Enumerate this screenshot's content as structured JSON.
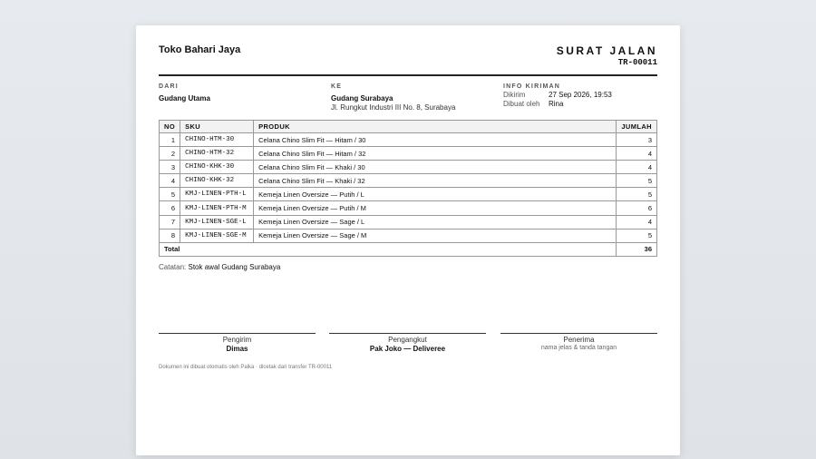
{
  "store_name": "Toko Bahari Jaya",
  "doc": {
    "title": "SURAT JALAN",
    "number": "TR-00011"
  },
  "from": {
    "label": "DARI",
    "name": "Gudang Utama"
  },
  "to": {
    "label": "KE",
    "name": "Gudang Surabaya",
    "address": "Jl. Rungkut Industri III No. 8, Surabaya"
  },
  "shipping": {
    "label": "INFO KIRIMAN",
    "sent_label": "Dikirim",
    "sent_value": "27 Sep 2026, 19:53",
    "by_label": "Dibuat oleh",
    "by_value": "Rina"
  },
  "table": {
    "headers": {
      "no": "NO",
      "sku": "SKU",
      "product": "PRODUK",
      "qty": "JUMLAH"
    },
    "rows": [
      {
        "no": "1",
        "sku": "CHINO-HTM-30",
        "product": "Celana Chino Slim Fit — Hitam / 30",
        "qty": "3"
      },
      {
        "no": "2",
        "sku": "CHINO-HTM-32",
        "product": "Celana Chino Slim Fit — Hitam / 32",
        "qty": "4"
      },
      {
        "no": "3",
        "sku": "CHINO-KHK-30",
        "product": "Celana Chino Slim Fit — Khaki / 30",
        "qty": "4"
      },
      {
        "no": "4",
        "sku": "CHINO-KHK-32",
        "product": "Celana Chino Slim Fit — Khaki / 32",
        "qty": "5"
      },
      {
        "no": "5",
        "sku": "KMJ-LINEN-PTH-L",
        "product": "Kemeja Linen Oversize — Putih / L",
        "qty": "5"
      },
      {
        "no": "6",
        "sku": "KMJ-LINEN-PTH-M",
        "product": "Kemeja Linen Oversize — Putih / M",
        "qty": "6"
      },
      {
        "no": "7",
        "sku": "KMJ-LINEN-SGE-L",
        "product": "Kemeja Linen Oversize — Sage / L",
        "qty": "4"
      },
      {
        "no": "8",
        "sku": "KMJ-LINEN-SGE-M",
        "product": "Kemeja Linen Oversize — Sage / M",
        "qty": "5"
      }
    ],
    "total_label": "Total",
    "total_value": "36"
  },
  "note": {
    "label": "Catatan:",
    "text": "Stok awal Gudang Surabaya"
  },
  "signatures": {
    "sender": {
      "role": "Pengirim",
      "name": "Dimas"
    },
    "carrier": {
      "role": "Pengangkut",
      "name": "Pak Joko — Deliveree"
    },
    "receiver": {
      "role": "Penerima",
      "hint": "nama jelas & tanda tangan"
    }
  },
  "footer": "Dokumen ini dibuat otomatis oleh Palka · dicetak dari transfer TR-00011"
}
